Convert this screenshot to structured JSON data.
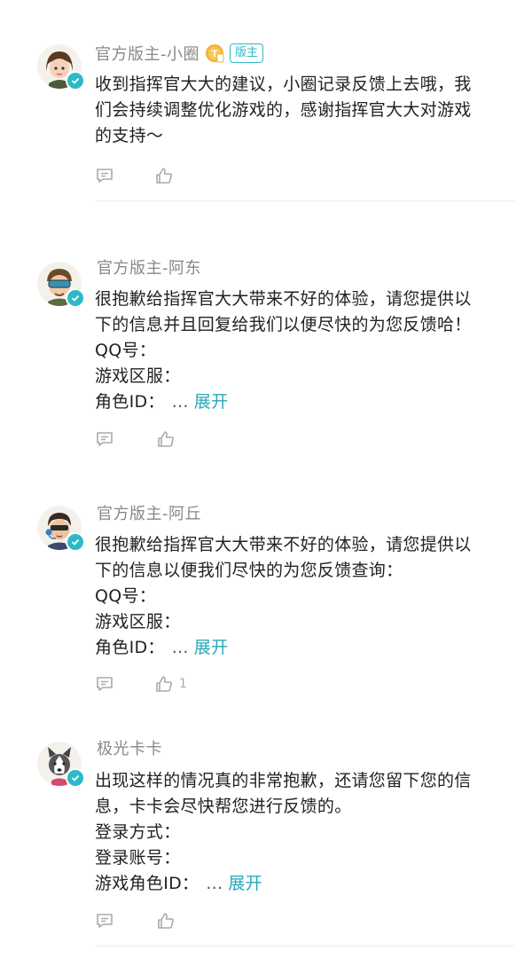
{
  "colors": {
    "accent": "#2db9c7",
    "link": "#2aa8b8",
    "name": "#888888",
    "text": "#222222",
    "icon": "#aaaaaa"
  },
  "comments": [
    {
      "name": "官方版主-小圈",
      "has_level_badge": true,
      "level_badge_text": "T",
      "mod_badge": "版主",
      "lines": [
        "收到指挥官大大的建议，小圈记录反馈上去哦，我",
        "们会持续调整优化游戏的，感谢指挥官大大对游戏",
        "的支持～"
      ],
      "like_count": ""
    },
    {
      "name": "官方版主-阿东",
      "lines": [
        "很抱歉给指挥官大大带来不好的体验，请您提供以",
        "下的信息并且回复给我们以便尽快的为您反馈哈！",
        "QQ号：",
        "游戏区服："
      ],
      "last_line": "角色ID：",
      "ellipsis": "...",
      "expand": "展开",
      "like_count": ""
    },
    {
      "name": "官方版主-阿丘",
      "lines": [
        "很抱歉给指挥官大大带来不好的体验，请您提供以",
        "下的信息以便我们尽快的为您反馈查询：",
        "QQ号：",
        "游戏区服："
      ],
      "last_line": "角色ID：",
      "ellipsis": "...",
      "expand": "展开",
      "like_count": "1"
    },
    {
      "name": "极光卡卡",
      "lines": [
        "出现这样的情况真的非常抱歉，还请您留下您的信",
        "息，卡卡会尽快帮您进行反馈的。",
        "登录方式：",
        "登录账号："
      ],
      "last_line": "游戏角色ID：",
      "ellipsis": "...",
      "expand": "展开",
      "like_count": ""
    }
  ]
}
